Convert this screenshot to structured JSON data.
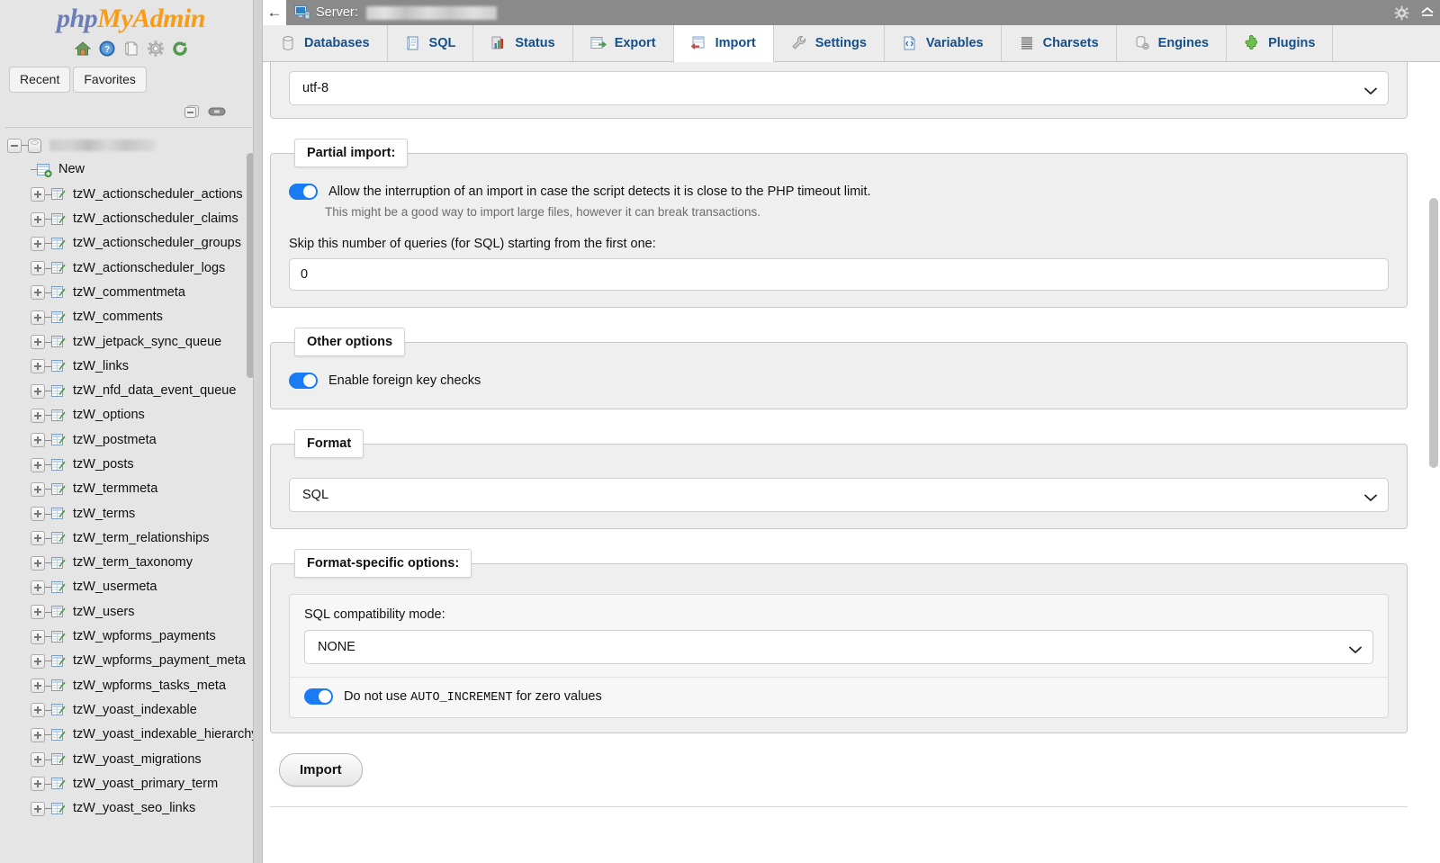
{
  "brand": {
    "logo_php": "php",
    "logo_my": "My",
    "logo_admin": "Admin",
    "icons": [
      "home-icon",
      "help-icon",
      "documentation-icon",
      "settings-gear-icon",
      "refresh-icon"
    ]
  },
  "sidebar": {
    "recent_tab": "Recent",
    "favorites_tab": "Favorites",
    "tools": [
      "collapse-all-icon",
      "link-with-main-panel-icon"
    ],
    "database_name": "",
    "new_item": "New",
    "tables": [
      "tzW_actionscheduler_actions",
      "tzW_actionscheduler_claims",
      "tzW_actionscheduler_groups",
      "tzW_actionscheduler_logs",
      "tzW_commentmeta",
      "tzW_comments",
      "tzW_jetpack_sync_queue",
      "tzW_links",
      "tzW_nfd_data_event_queue",
      "tzW_options",
      "tzW_postmeta",
      "tzW_posts",
      "tzW_termmeta",
      "tzW_terms",
      "tzW_term_relationships",
      "tzW_term_taxonomy",
      "tzW_usermeta",
      "tzW_users",
      "tzW_wpforms_payments",
      "tzW_wpforms_payment_meta",
      "tzW_wpforms_tasks_meta",
      "tzW_yoast_indexable",
      "tzW_yoast_indexable_hierarchy",
      "tzW_yoast_migrations",
      "tzW_yoast_primary_term",
      "tzW_yoast_seo_links"
    ]
  },
  "topbar": {
    "back_label": "←",
    "server_label": "Server:",
    "server_value_redacted": true,
    "gear_icon": "settings-gear-icon",
    "collapse_icon": "collapse-icon"
  },
  "navtabs": [
    {
      "label": "Databases",
      "icon": "database-icon",
      "active": false
    },
    {
      "label": "SQL",
      "icon": "sql-icon",
      "active": false
    },
    {
      "label": "Status",
      "icon": "status-icon",
      "active": false
    },
    {
      "label": "Export",
      "icon": "export-icon",
      "active": false
    },
    {
      "label": "Import",
      "icon": "import-icon",
      "active": true
    },
    {
      "label": "Settings",
      "icon": "wrench-icon",
      "active": false
    },
    {
      "label": "Variables",
      "icon": "variables-icon",
      "active": false
    },
    {
      "label": "Charsets",
      "icon": "charsets-icon",
      "active": false
    },
    {
      "label": "Engines",
      "icon": "engines-icon",
      "active": false
    },
    {
      "label": "Plugins",
      "icon": "plugins-icon",
      "active": false
    }
  ],
  "main": {
    "charset": {
      "value": "utf-8"
    },
    "partial_import": {
      "legend": "Partial import:",
      "allow_interruption_label": "Allow the interruption of an import in case the script detects it is close to the PHP timeout limit.",
      "allow_interruption_on": true,
      "allow_interruption_note": "This might be a good way to import large files, however it can break transactions.",
      "skip_queries_label": "Skip this number of queries (for SQL) starting from the first one:",
      "skip_queries_value": "0"
    },
    "other_options": {
      "legend": "Other options",
      "foreign_key_label": "Enable foreign key checks",
      "foreign_key_on": true
    },
    "format": {
      "legend": "Format",
      "value": "SQL"
    },
    "format_specific": {
      "legend": "Format-specific options:",
      "compat_label": "SQL compatibility mode:",
      "compat_value": "NONE",
      "auto_increment_label_pre": "Do not use ",
      "auto_increment_mono": "AUTO_INCREMENT",
      "auto_increment_label_post": " for zero values",
      "auto_increment_on": true
    },
    "import_button": "Import"
  },
  "colors": {
    "brand_blue": "#6c7eb7",
    "brand_orange": "#f89b15",
    "tab_link": "#16508a",
    "toggle_on": "#1a7cf5",
    "topbar_gray": "#8a8a8a"
  }
}
